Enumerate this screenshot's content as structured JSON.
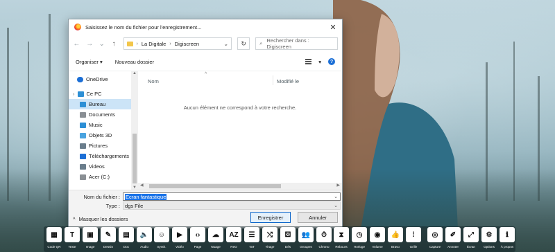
{
  "dialog": {
    "title": "Saisissez le nom du fichier pour l'enregistrement...",
    "close_glyph": "✕",
    "nav": {
      "back": "←",
      "forward": "→",
      "recent": "⌄",
      "up": "↑"
    },
    "breadcrumb": [
      "La Digitale",
      "Digiscreen"
    ],
    "refresh_glyph": "↻",
    "search_placeholder": "Rechercher dans : Digiscreen",
    "toolbar": {
      "organize": "Organiser",
      "new_folder": "Nouveau dossier",
      "help": "?"
    },
    "sidebar": [
      {
        "label": "OneDrive",
        "icon": "cloud-icon",
        "color": "#1c6fd6"
      },
      {
        "label": "Ce PC",
        "icon": "computer-icon",
        "color": "#2d8fd5"
      },
      {
        "label": "Bureau",
        "icon": "desktop-icon",
        "color": "#2d8fd5",
        "selected": true
      },
      {
        "label": "Documents",
        "icon": "document-icon",
        "color": "#8a8f94"
      },
      {
        "label": "Music",
        "icon": "music-icon",
        "color": "#2d8fd5"
      },
      {
        "label": "Objets 3D",
        "icon": "cube-icon",
        "color": "#4aa3df"
      },
      {
        "label": "Pictures",
        "icon": "picture-icon",
        "color": "#6a7d8c"
      },
      {
        "label": "Téléchargements",
        "icon": "download-icon",
        "color": "#1c6fd6"
      },
      {
        "label": "Videos",
        "icon": "video-icon",
        "color": "#6a7d8c"
      },
      {
        "label": "Acer (C:)",
        "icon": "drive-icon",
        "color": "#8a8f94"
      }
    ],
    "columns": [
      "Nom",
      "Modifié le"
    ],
    "empty_message": "Aucun élément ne correspond à votre recherche.",
    "filename_label": "Nom du fichier :",
    "filename_value": "Ecran fantastique",
    "type_label": "Type :",
    "type_value": "dgs File",
    "hide_folders": "Masquer les dossiers",
    "save_button": "Enregistrer",
    "cancel_button": "Annuler"
  },
  "dock": {
    "tools": [
      {
        "label": "Code QR",
        "glyph": "▦"
      },
      {
        "label": "Texte",
        "glyph": "T"
      },
      {
        "label": "Image",
        "glyph": "▣"
      },
      {
        "label": "Dessin",
        "glyph": "✎"
      },
      {
        "label": "Doc",
        "glyph": "▤"
      },
      {
        "label": "Audio",
        "glyph": "🔈"
      },
      {
        "label": "Synth.",
        "glyph": "☺"
      },
      {
        "label": "Vidéo",
        "glyph": "▶"
      },
      {
        "label": "Page",
        "glyph": "‹›"
      },
      {
        "label": "Nuage",
        "glyph": "☁"
      },
      {
        "label": "ReO",
        "glyph": "AZ"
      },
      {
        "label": "TaT",
        "glyph": "☰"
      },
      {
        "label": "Tirage",
        "glyph": "⤭"
      },
      {
        "label": "Dés",
        "glyph": "⚄"
      },
      {
        "label": "Groupes",
        "glyph": "👥"
      },
      {
        "label": "Chrono",
        "glyph": "⏱"
      },
      {
        "label": "Rebours",
        "glyph": "⧗"
      },
      {
        "label": "Horloge",
        "glyph": "◷"
      },
      {
        "label": "Volume",
        "glyph": "◉"
      },
      {
        "label": "Bravo",
        "glyph": "👍"
      },
      {
        "label": "Grille",
        "glyph": "⁞"
      },
      {
        "label": "Capture",
        "glyph": "◎"
      },
      {
        "label": "Annoter",
        "glyph": "✐"
      },
      {
        "label": "Écran",
        "glyph": "⤢"
      },
      {
        "label": "Options",
        "glyph": "⚙"
      },
      {
        "label": "À propos",
        "glyph": "ℹ"
      }
    ]
  }
}
